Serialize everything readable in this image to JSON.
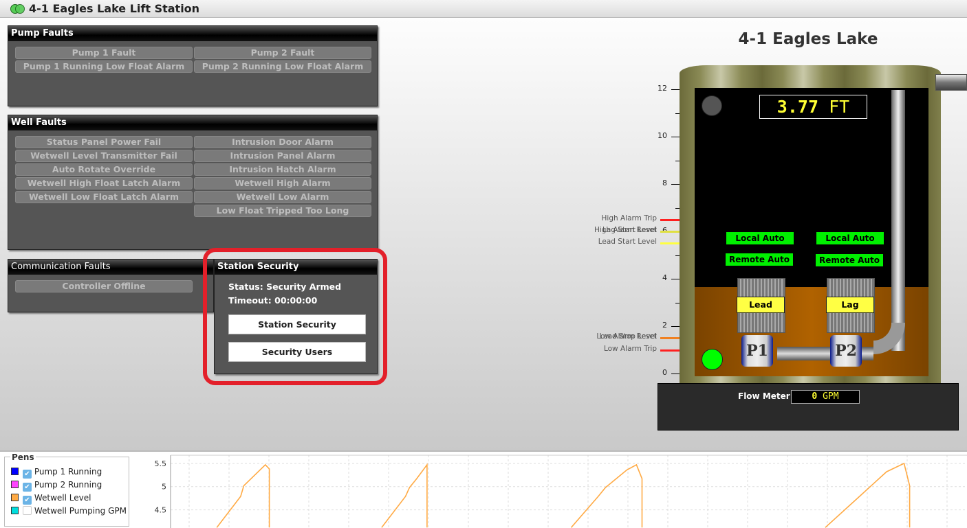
{
  "window": {
    "title": "4-1 Eagles Lake Lift Station",
    "icon": "double-circle-logo-icon"
  },
  "pump_faults": {
    "title": "Pump Faults",
    "items": [
      "Pump 1 Fault",
      "Pump 2 Fault",
      "Pump 1 Running Low Float Alarm",
      "Pump 2 Running Low Float Alarm"
    ]
  },
  "well_faults": {
    "title": "Well Faults",
    "left": [
      "Status Panel Power Fail",
      "Wetwell Level Transmitter Fail",
      "Auto Rotate Override",
      "Wetwell High Float Latch Alarm",
      "Wetwell Low Float Latch Alarm"
    ],
    "right": [
      "Intrusion Door Alarm",
      "Intrusion Panel Alarm",
      "Intrusion Hatch Alarm",
      "Wetwell High Alarm",
      "Wetwell Low Alarm",
      "Low Float Tripped Too Long"
    ]
  },
  "comm_faults": {
    "title": "Communication Faults",
    "items": [
      "Controller Offline"
    ]
  },
  "security": {
    "title": "Station Security",
    "status": "Status: Security Armed",
    "timeout": "Timeout: 00:00:00",
    "btn_security": "Station Security",
    "btn_users": "Security Users",
    "highlight_color": "#e3202a"
  },
  "station": {
    "title": "4-1 Eagles Lake",
    "level_value": "3.77",
    "level_unit": "FT",
    "level_ft": 3.77,
    "scale_ticks": [
      "12",
      "10",
      "8",
      "6",
      "4",
      "2",
      "0"
    ],
    "setpoints": [
      {
        "label": "High Alarm Trip",
        "color": "#ff2020"
      },
      {
        "label": "High Alarm Reset",
        "color": "#e0e040"
      },
      {
        "label": "Lag Start Level",
        "color": "#e0e040"
      },
      {
        "label": "Lead Start Level",
        "color": "#ffff40"
      },
      {
        "label": "Low Alarm Reset",
        "color": "#f08020"
      },
      {
        "label": "Lead Stop Level",
        "color": "#f08020"
      },
      {
        "label": "Low Alarm Trip",
        "color": "#ff2020"
      }
    ],
    "pumps": [
      {
        "name": "P1",
        "local": "Local Auto",
        "remote": "Remote Auto",
        "role": "Lead"
      },
      {
        "name": "P2",
        "local": "Local Auto",
        "remote": "Remote Auto",
        "role": "Lag"
      }
    ],
    "indicator_top_color": "#555555",
    "indicator_bottom_color": "#00ff00",
    "flow_label": "Flow Meter",
    "flow_value": "0",
    "flow_unit": "GPM"
  },
  "pens": {
    "title": "Pens",
    "items": [
      {
        "label": "Pump 1 Running",
        "color": "#0000ff",
        "checked": true
      },
      {
        "label": "Pump 2 Running",
        "color": "#ff44ff",
        "checked": true
      },
      {
        "label": "Wetwell Level",
        "color": "#ffaa44",
        "checked": true
      },
      {
        "label": "Wetwell Pumping GPM",
        "color": "#00dddd",
        "checked": false
      }
    ]
  },
  "chart_data": {
    "type": "line",
    "ylim": [
      4.11,
      5.72
    ],
    "yticks": [
      "5.5",
      "5",
      "4.5"
    ],
    "ytick_values": [
      5.5,
      5,
      4.5
    ],
    "grid": true,
    "series": [
      {
        "name": "Wetwell Level",
        "color": "#ffaa44",
        "points": [
          [
            5.8,
            4.12
          ],
          [
            8.8,
            4.79
          ],
          [
            9.2,
            5.02
          ],
          [
            10.1,
            5.17
          ],
          [
            11.9,
            5.47
          ],
          [
            12.4,
            5.38
          ],
          [
            12.4,
            4.12
          ],
          null,
          [
            26.5,
            4.12
          ],
          [
            29.5,
            4.79
          ],
          [
            30.0,
            4.98
          ],
          [
            30.9,
            5.17
          ],
          [
            32.2,
            5.47
          ],
          [
            32.2,
            4.12
          ],
          null,
          [
            50.3,
            4.12
          ],
          [
            53.7,
            4.79
          ],
          [
            54.6,
            4.98
          ],
          [
            57.3,
            5.36
          ],
          [
            58.5,
            5.47
          ],
          [
            59.2,
            5.17
          ],
          [
            59.2,
            4.12
          ],
          null,
          [
            82.2,
            4.12
          ],
          [
            86.5,
            4.79
          ],
          [
            89.9,
            5.32
          ],
          [
            92.1,
            5.5
          ],
          [
            92.8,
            5.02
          ],
          [
            92.8,
            4.12
          ]
        ]
      }
    ]
  }
}
